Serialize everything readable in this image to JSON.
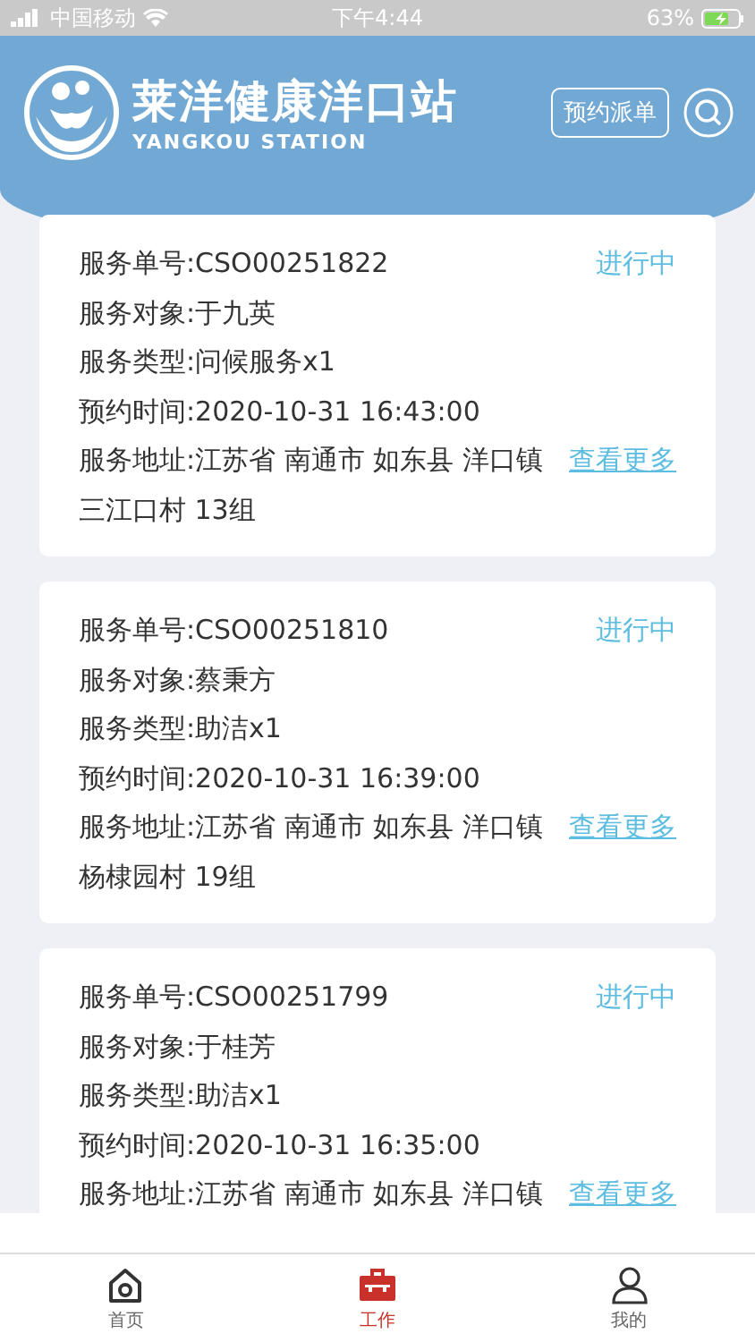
{
  "status_bar": {
    "carrier": "中国移动",
    "time": "下午4:44",
    "battery": "63%"
  },
  "header": {
    "title": "莱洋健康洋口站",
    "subtitle": "YANGKOU STATION",
    "action": "预约派单"
  },
  "orders": [
    {
      "status": "进行中",
      "lines": [
        "服务单号:CSO00251822",
        "服务对象:于九英",
        "服务类型:问候服务x1",
        "预约时间:2020-10-31 16:43:00"
      ],
      "address": "服务地址:江苏省 南通市 如东县 洋口镇",
      "address_more": "三江口村 13组",
      "link": "查看更多"
    },
    {
      "status": "进行中",
      "lines": [
        "服务单号:CSO00251810",
        "服务对象:蔡秉方",
        "服务类型:助洁x1",
        "预约时间:2020-10-31 16:39:00"
      ],
      "address": "服务地址:江苏省 南通市 如东县 洋口镇",
      "address_more": "杨棣园村 19组",
      "link": "查看更多"
    },
    {
      "status": "进行中",
      "lines": [
        "服务单号:CSO00251799",
        "服务对象:于桂芳",
        "服务类型:助洁x1",
        "预约时间:2020-10-31 16:35:00"
      ],
      "address": "服务地址:江苏省 南通市 如东县 洋口镇",
      "link": "查看更多"
    }
  ],
  "tabs": [
    {
      "label": "首页",
      "kind": "home",
      "selected": false
    },
    {
      "label": "工作",
      "kind": "work",
      "selected": true
    },
    {
      "label": "我的",
      "kind": "profile",
      "selected": false
    }
  ]
}
